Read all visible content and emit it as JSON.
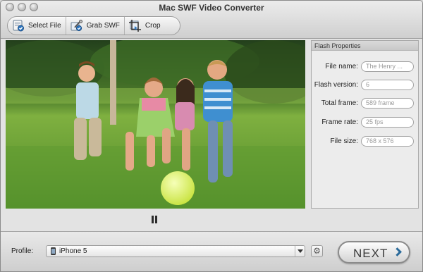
{
  "window": {
    "title": "Mac SWF Video Converter"
  },
  "toolbar": {
    "buttons": [
      {
        "label": "Select File",
        "icon": "select-file-icon"
      },
      {
        "label": "Grab SWF",
        "icon": "grab-swf-icon"
      },
      {
        "label": "Crop",
        "icon": "crop-icon"
      }
    ]
  },
  "properties": {
    "header": "Flash Properties",
    "rows": [
      {
        "label": "File name:",
        "value": "The Henry ..."
      },
      {
        "label": "Flash version:",
        "value": "6"
      },
      {
        "label": "Total frame:",
        "value": "589 frame"
      },
      {
        "label": "Frame rate:",
        "value": "25 fps"
      },
      {
        "label": "File size:",
        "value": "768 x 576"
      }
    ]
  },
  "playback": {
    "state_icon": "pause-icon"
  },
  "footer": {
    "profile_label": "Profile:",
    "profile_value": "iPhone 5",
    "next_label": "NEXT"
  },
  "colors": {
    "accent": "#2a6a9a",
    "toolbar_bg": "#e3e3e3",
    "grass": "#5f9435"
  }
}
